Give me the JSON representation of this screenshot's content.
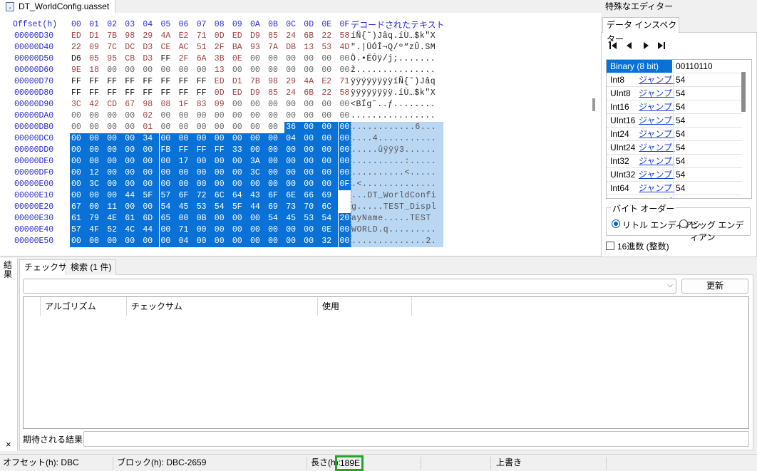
{
  "file_tab": {
    "title": "DT_WorldConfig.uasset"
  },
  "hex": {
    "offset_header": "Offset(h)",
    "columns": [
      "00",
      "01",
      "02",
      "03",
      "04",
      "05",
      "06",
      "07",
      "08",
      "09",
      "0A",
      "0B",
      "0C",
      "0D",
      "0E",
      "0F"
    ],
    "text_header": "デコードされたテキスト",
    "rows": [
      {
        "offset": "00000D30",
        "bytes": [
          "ED",
          "D1",
          "7B",
          "98",
          "29",
          "4A",
          "E2",
          "71",
          "0D",
          "ED",
          "D9",
          "85",
          "24",
          "6B",
          "22",
          "58"
        ],
        "text": "íÑ{˜)Jâq.íÙ…$k\"X"
      },
      {
        "offset": "00000D40",
        "bytes": [
          "22",
          "09",
          "7C",
          "DC",
          "D3",
          "CE",
          "AC",
          "51",
          "2F",
          "BA",
          "93",
          "7A",
          "DB",
          "13",
          "53",
          "4D"
        ],
        "text": "\".|ÜÓÎ¬Q/º“zÛ.SM"
      },
      {
        "offset": "00000D50",
        "bytes": [
          "D6",
          "05",
          "95",
          "CB",
          "D3",
          "FF",
          "2F",
          "6A",
          "3B",
          "0E",
          "00",
          "00",
          "00",
          "00",
          "00",
          "00"
        ],
        "text": "Ö.•ËÓÿ/j;......."
      },
      {
        "offset": "00000D60",
        "bytes": [
          "9E",
          "18",
          "00",
          "00",
          "00",
          "00",
          "00",
          "00",
          "13",
          "00",
          "00",
          "00",
          "00",
          "00",
          "00",
          "00"
        ],
        "text": "ž..............."
      },
      {
        "offset": "00000D70",
        "bytes": [
          "FF",
          "FF",
          "FF",
          "FF",
          "FF",
          "FF",
          "FF",
          "FF",
          "ED",
          "D1",
          "7B",
          "98",
          "29",
          "4A",
          "E2",
          "71"
        ],
        "text": "ÿÿÿÿÿÿÿÿíÑ{˜)Jâq"
      },
      {
        "offset": "00000D80",
        "bytes": [
          "FF",
          "FF",
          "FF",
          "FF",
          "FF",
          "FF",
          "FF",
          "FF",
          "0D",
          "ED",
          "D9",
          "85",
          "24",
          "6B",
          "22",
          "58"
        ],
        "text": "ÿÿÿÿÿÿÿÿ.íÙ…$k\"X"
      },
      {
        "offset": "00000D90",
        "bytes": [
          "3C",
          "42",
          "CD",
          "67",
          "98",
          "08",
          "1F",
          "83",
          "09",
          "00",
          "00",
          "00",
          "00",
          "00",
          "00",
          "00"
        ],
        "text": "<BÍg˜..ƒ........"
      },
      {
        "offset": "00000DA0",
        "bytes": [
          "00",
          "00",
          "00",
          "00",
          "02",
          "00",
          "00",
          "00",
          "00",
          "00",
          "00",
          "00",
          "00",
          "00",
          "00",
          "00"
        ],
        "text": "................"
      },
      {
        "offset": "00000DB0",
        "bytes": [
          "00",
          "00",
          "00",
          "00",
          "01",
          "00",
          "00",
          "00",
          "00",
          "00",
          "00",
          "00",
          "36",
          "00",
          "00",
          "00"
        ],
        "text": "............6..."
      },
      {
        "offset": "00000DC0",
        "bytes": [
          "00",
          "00",
          "00",
          "00",
          "34",
          "00",
          "00",
          "00",
          "00",
          "00",
          "00",
          "00",
          "04",
          "00",
          "00",
          "00"
        ],
        "text": "....4..........."
      },
      {
        "offset": "00000DD0",
        "bytes": [
          "00",
          "00",
          "00",
          "00",
          "00",
          "FB",
          "FF",
          "FF",
          "FF",
          "33",
          "00",
          "00",
          "00",
          "00",
          "00",
          "00"
        ],
        "text": ".....ûÿÿÿ3......"
      },
      {
        "offset": "00000DE0",
        "bytes": [
          "00",
          "00",
          "00",
          "00",
          "00",
          "00",
          "17",
          "00",
          "00",
          "00",
          "3A",
          "00",
          "00",
          "00",
          "00",
          "00"
        ],
        "text": "..........:....."
      },
      {
        "offset": "00000DF0",
        "bytes": [
          "00",
          "12",
          "00",
          "00",
          "00",
          "00",
          "00",
          "00",
          "00",
          "00",
          "3C",
          "00",
          "00",
          "00",
          "00",
          "00"
        ],
        "text": "..........<....."
      },
      {
        "offset": "00000E00",
        "bytes": [
          "00",
          "3C",
          "00",
          "00",
          "00",
          "00",
          "00",
          "00",
          "00",
          "00",
          "00",
          "00",
          "00",
          "00",
          "00",
          "0F"
        ],
        "text": ".<.............."
      },
      {
        "offset": "00000E10",
        "bytes": [
          "00",
          "00",
          "00",
          "44",
          "5F",
          "57",
          "6F",
          "72",
          "6C",
          "64",
          "43",
          "6F",
          "6E",
          "66",
          "69"
        ],
        "text": "...DT_WorldConfi"
      },
      {
        "offset": "00000E20",
        "bytes": [
          "67",
          "00",
          "11",
          "00",
          "00",
          "54",
          "45",
          "53",
          "54",
          "5F",
          "44",
          "69",
          "73",
          "70",
          "6C"
        ],
        "text": "g.....TEST_Displ"
      },
      {
        "offset": "00000E30",
        "bytes": [
          "61",
          "79",
          "4E",
          "61",
          "6D",
          "65",
          "00",
          "0B",
          "00",
          "00",
          "00",
          "54",
          "45",
          "53",
          "54",
          "20"
        ],
        "text": "ayName.....TEST "
      },
      {
        "offset": "00000E40",
        "bytes": [
          "57",
          "4F",
          "52",
          "4C",
          "44",
          "00",
          "71",
          "00",
          "00",
          "00",
          "00",
          "00",
          "00",
          "00",
          "0E",
          "00"
        ],
        "text": "WORLD.q........."
      },
      {
        "offset": "00000E50",
        "bytes": [
          "00",
          "00",
          "00",
          "00",
          "00",
          "00",
          "04",
          "00",
          "00",
          "00",
          "00",
          "00",
          "00",
          "00",
          "32",
          "00"
        ],
        "text": "..............2."
      }
    ],
    "selection_start_row": 8,
    "selection_start_col": 12
  },
  "inspector": {
    "panel_title": "特殊なエディター",
    "tab_label": "データ インスペクター",
    "nav_icons": [
      "first-icon",
      "prev-icon",
      "next-icon",
      "last-icon"
    ],
    "jump_label": "ジャンプ:",
    "rows": [
      {
        "name": "Binary (8 bit)",
        "value": "00110110",
        "jump": false
      },
      {
        "name": "Int8",
        "value": "54",
        "jump": true
      },
      {
        "name": "UInt8",
        "value": "54",
        "jump": true
      },
      {
        "name": "Int16",
        "value": "54",
        "jump": true
      },
      {
        "name": "UInt16",
        "value": "54",
        "jump": true
      },
      {
        "name": "Int24",
        "value": "54",
        "jump": true
      },
      {
        "name": "UInt24",
        "value": "54",
        "jump": true
      },
      {
        "name": "Int32",
        "value": "54",
        "jump": true
      },
      {
        "name": "UInt32",
        "value": "54",
        "jump": true
      },
      {
        "name": "Int64",
        "value": "54",
        "jump": true
      },
      {
        "name": "UInt64",
        "value": "",
        "jump": true
      }
    ],
    "byte_order_label": "バイト オーダー",
    "little_endian": "リトル エンディアン",
    "big_endian": "ビッグ エンディアン",
    "hex_checkbox": "16進数 (整数)"
  },
  "results": {
    "side_label": "結果",
    "close": "×",
    "tab_checksum": "チェックサム",
    "tab_search": "検索 (1 件)",
    "update_button": "更新",
    "columns": [
      "アルゴリズム",
      "チェックサム",
      "使用"
    ],
    "expected_label": "期待される結果:"
  },
  "status": {
    "offset": "オフセット(h): DBC",
    "block": "ブロック(h): DBC-2659",
    "length_label": "長さ(h):",
    "length_value": "189E",
    "mode": "上書き"
  },
  "colors": {
    "selection": "#0a72d6",
    "text_selection": "#b9d6f3",
    "offset": "#2a2ad0",
    "highlight_box": "#1ea82e"
  }
}
